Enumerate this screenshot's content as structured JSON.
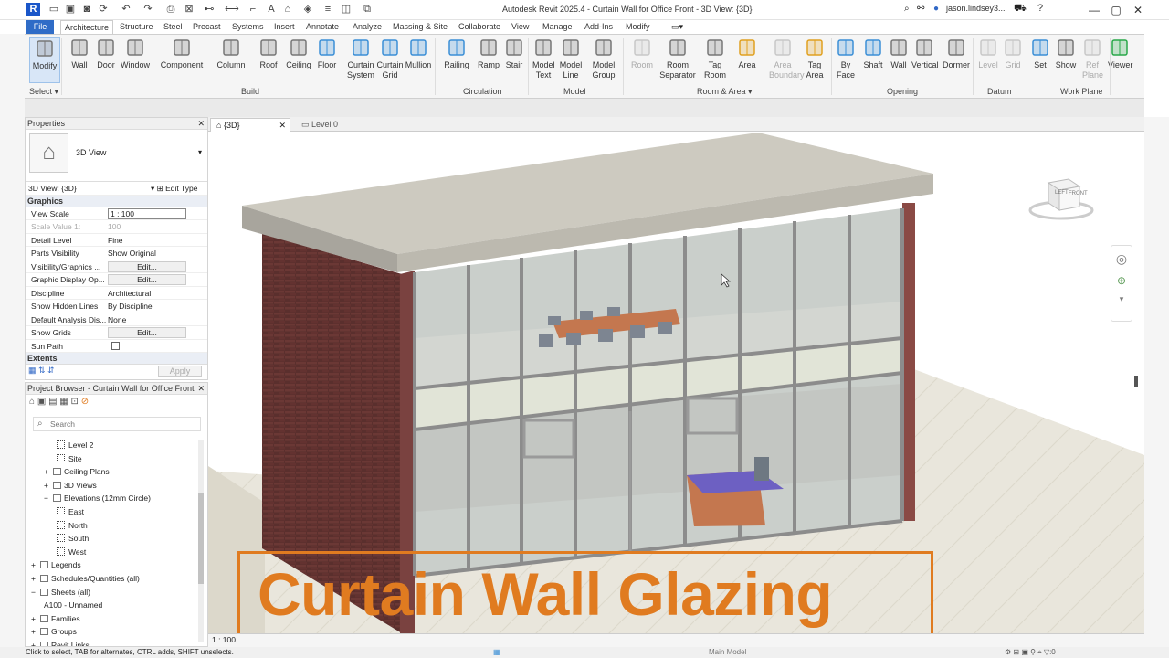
{
  "titlebar": {
    "app_logo": "R",
    "title": "Autodesk Revit 2025.4 - Curtain Wall for Office Front - 3D View: {3D}",
    "user": "jason.lindsey3...",
    "help": "?"
  },
  "tabs": [
    "File",
    "Architecture",
    "Structure",
    "Steel",
    "Precast",
    "Systems",
    "Insert",
    "Annotate",
    "Analyze",
    "Massing & Site",
    "Collaborate",
    "View",
    "Manage",
    "Add-Ins",
    "Modify"
  ],
  "ribbon": {
    "buttons": [
      {
        "label": "Modify",
        "icon": "cursor-icon"
      },
      {
        "label": "Wall",
        "icon": "wall-icon"
      },
      {
        "label": "Door",
        "icon": "door-icon"
      },
      {
        "label": "Window",
        "icon": "window-icon"
      },
      {
        "label": "Component",
        "icon": "component-icon"
      },
      {
        "label": "Column",
        "icon": "column-icon"
      },
      {
        "label": "Roof",
        "icon": "roof-icon"
      },
      {
        "label": "Ceiling",
        "icon": "ceiling-icon"
      },
      {
        "label": "Floor",
        "icon": "floor-icon"
      },
      {
        "label": "Curtain\nSystem",
        "icon": "curtain-system-icon"
      },
      {
        "label": "Curtain\nGrid",
        "icon": "curtain-grid-icon"
      },
      {
        "label": "Mullion",
        "icon": "mullion-icon"
      },
      {
        "label": "Railing",
        "icon": "railing-icon"
      },
      {
        "label": "Ramp",
        "icon": "ramp-icon"
      },
      {
        "label": "Stair",
        "icon": "stair-icon"
      },
      {
        "label": "Model\nText",
        "icon": "model-text-icon"
      },
      {
        "label": "Model\nLine",
        "icon": "model-line-icon"
      },
      {
        "label": "Model\nGroup",
        "icon": "model-group-icon"
      },
      {
        "label": "Room",
        "icon": "room-icon",
        "disabled": true
      },
      {
        "label": "Room\nSeparator",
        "icon": "room-separator-icon"
      },
      {
        "label": "Tag\nRoom",
        "icon": "tag-room-icon"
      },
      {
        "label": "Area",
        "icon": "area-icon"
      },
      {
        "label": "Area\nBoundary",
        "icon": "area-boundary-icon",
        "disabled": true
      },
      {
        "label": "Tag\nArea",
        "icon": "tag-area-icon"
      },
      {
        "label": "By\nFace",
        "icon": "by-face-icon"
      },
      {
        "label": "Shaft",
        "icon": "shaft-icon"
      },
      {
        "label": "Wall",
        "icon": "wall-opening-icon"
      },
      {
        "label": "Vertical",
        "icon": "vertical-icon"
      },
      {
        "label": "Dormer",
        "icon": "dormer-icon"
      },
      {
        "label": "Level",
        "icon": "level-icon",
        "disabled": true
      },
      {
        "label": "Grid",
        "icon": "grid-icon",
        "disabled": true
      },
      {
        "label": "Set",
        "icon": "set-icon"
      },
      {
        "label": "Show",
        "icon": "show-icon"
      },
      {
        "label": "Ref\nPlane",
        "icon": "ref-plane-icon",
        "disabled": true
      },
      {
        "label": "Viewer",
        "icon": "viewer-icon"
      }
    ],
    "groups": [
      "Select",
      "Build",
      "Circulation",
      "Model",
      "Room & Area",
      "Opening",
      "Datum",
      "Work Plane"
    ]
  },
  "properties": {
    "header": "Properties",
    "type": "3D View",
    "view_selector": "3D View: {3D}",
    "edit_type": "Edit Type",
    "section_graphics": "Graphics",
    "rows": [
      {
        "k": "View Scale",
        "v": "1 : 100",
        "input": true
      },
      {
        "k": "Scale Value    1:",
        "v": "100",
        "dim": true
      },
      {
        "k": "Detail Level",
        "v": "Fine"
      },
      {
        "k": "Parts Visibility",
        "v": "Show Original"
      },
      {
        "k": "Visibility/Graphics ...",
        "v": "Edit...",
        "btn": true
      },
      {
        "k": "Graphic Display Op...",
        "v": "Edit...",
        "btn": true
      },
      {
        "k": "Discipline",
        "v": "Architectural"
      },
      {
        "k": "Show Hidden Lines",
        "v": "By Discipline"
      },
      {
        "k": "Default Analysis Dis...",
        "v": "None"
      },
      {
        "k": "Show Grids",
        "v": "Edit...",
        "btn": true
      },
      {
        "k": "Sun Path",
        "v": ""
      }
    ],
    "section_extents": "Extents",
    "apply": "Apply"
  },
  "browser": {
    "header": "Project Browser - Curtain Wall for Office Front",
    "search_placeholder": "Search",
    "items": [
      {
        "label": "Level 2",
        "indent": 2,
        "view": true
      },
      {
        "label": "Site",
        "indent": 2,
        "view": true
      },
      {
        "label": "Ceiling Plans",
        "indent": 1,
        "toggle": "+"
      },
      {
        "label": "3D Views",
        "indent": 1,
        "toggle": "+"
      },
      {
        "label": "Elevations (12mm Circle)",
        "indent": 1,
        "toggle": "−"
      },
      {
        "label": "East",
        "indent": 2,
        "view": true
      },
      {
        "label": "North",
        "indent": 2,
        "view": true
      },
      {
        "label": "South",
        "indent": 2,
        "view": true
      },
      {
        "label": "West",
        "indent": 2,
        "view": true
      },
      {
        "label": "Legends",
        "indent": 0,
        "toggle": "+"
      },
      {
        "label": "Schedules/Quantities (all)",
        "indent": 0,
        "toggle": "+"
      },
      {
        "label": "Sheets (all)",
        "indent": 0,
        "toggle": "−"
      },
      {
        "label": "A100 - Unnamed",
        "indent": 1
      },
      {
        "label": "Families",
        "indent": 0,
        "toggle": "+"
      },
      {
        "label": "Groups",
        "indent": 0,
        "toggle": "+"
      },
      {
        "label": "Revit Links",
        "indent": 0,
        "toggle": "+"
      }
    ]
  },
  "view_tabs": [
    {
      "label": "{3D}",
      "active": true
    },
    {
      "label": "Level 0",
      "active": false
    }
  ],
  "navcube": {
    "left": "LEFT",
    "front": "FRONT"
  },
  "overlay": "Curtain Wall Glazing",
  "viewport_scale": "1 : 100",
  "status": {
    "hint": "Click to select, TAB for alternates, CTRL adds, SHIFT unselects.",
    "model": "Main Model"
  }
}
